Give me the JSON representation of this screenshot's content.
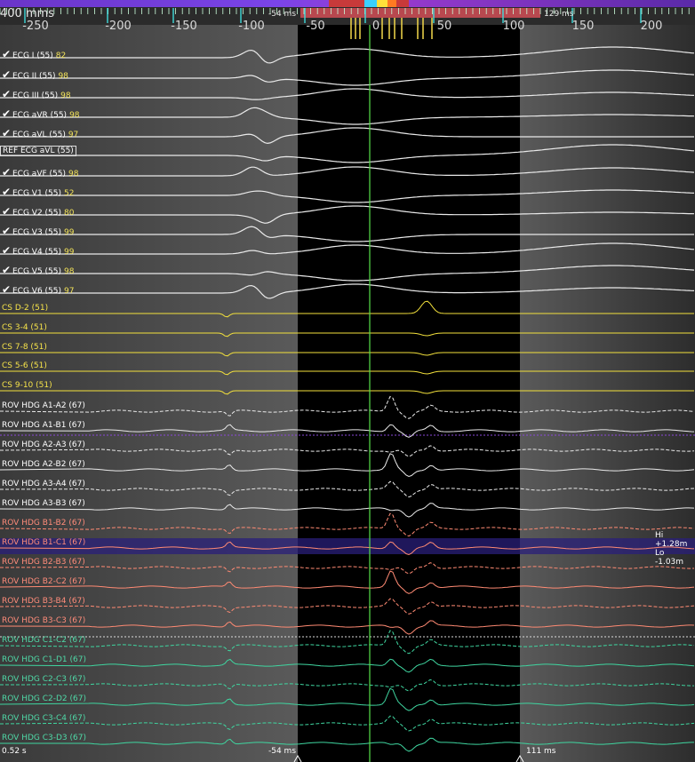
{
  "header": {
    "sweep_speed": "400 mms",
    "marker_left": "-54 ms",
    "marker_right": "129 ms",
    "ticks": [
      "-250",
      "-200",
      "-150",
      "-100",
      "-50",
      "0",
      "50",
      "100",
      "150",
      "200"
    ]
  },
  "channels": [
    {
      "label": "ECG I (55)",
      "score": "82",
      "checked": true,
      "color": "white"
    },
    {
      "label": "ECG II (55)",
      "score": "98",
      "checked": true,
      "color": "white"
    },
    {
      "label": "ECG III (55)",
      "score": "98",
      "checked": true,
      "color": "white"
    },
    {
      "label": "ECG aVR (55)",
      "score": "98",
      "checked": true,
      "color": "white"
    },
    {
      "label": "ECG aVL (55)",
      "score": "97",
      "checked": true,
      "color": "white"
    },
    {
      "label": "REF ECG aVL (55)",
      "score": "",
      "checked": false,
      "color": "white",
      "ref": true
    },
    {
      "label": "ECG aVF (55)",
      "score": "98",
      "checked": true,
      "color": "white"
    },
    {
      "label": "ECG V1 (55)",
      "score": "52",
      "checked": true,
      "color": "white"
    },
    {
      "label": "ECG V2 (55)",
      "score": "80",
      "checked": true,
      "color": "white"
    },
    {
      "label": "ECG V3 (55)",
      "score": "99",
      "checked": true,
      "color": "white"
    },
    {
      "label": "ECG V4 (55)",
      "score": "99",
      "checked": true,
      "color": "white"
    },
    {
      "label": "ECG V5 (55)",
      "score": "98",
      "checked": true,
      "color": "white"
    },
    {
      "label": "ECG V6 (55)",
      "score": "97",
      "checked": true,
      "color": "white"
    },
    {
      "label": "CS   D-2 (51)",
      "color": "yellow"
    },
    {
      "label": "CS   3-4 (51)",
      "color": "yellow"
    },
    {
      "label": "CS   7-8 (51)",
      "color": "yellow"
    },
    {
      "label": "CS   5-6 (51)",
      "color": "yellow"
    },
    {
      "label": "CS   9-10 (51)",
      "color": "yellow"
    },
    {
      "label": "ROV HDG   A1-A2 (67)",
      "color": "white"
    },
    {
      "label": "ROV HDG   A1-B1 (67)",
      "color": "white"
    },
    {
      "label": "ROV HDG   A2-A3 (67)",
      "color": "white"
    },
    {
      "label": "ROV HDG   A2-B2 (67)",
      "color": "white"
    },
    {
      "label": "ROV HDG   A3-A4 (67)",
      "color": "white"
    },
    {
      "label": "ROV HDG   A3-B3 (67)",
      "color": "white"
    },
    {
      "label": "ROV HDG   B1-B2 (67)",
      "color": "salmon"
    },
    {
      "label": "ROV HDG   B1-C1 (67)",
      "color": "salmon"
    },
    {
      "label": "ROV HDG   B2-B3 (67)",
      "color": "salmon"
    },
    {
      "label": "ROV HDG   B2-C2 (67)",
      "color": "salmon"
    },
    {
      "label": "ROV HDG   B3-B4 (67)",
      "color": "salmon"
    },
    {
      "label": "ROV HDG   B3-C3 (67)",
      "color": "salmon"
    },
    {
      "label": "ROV HDG   C1-C2 (67)",
      "color": "green"
    },
    {
      "label": "ROV HDG   C1-D1 (67)",
      "color": "green"
    },
    {
      "label": "ROV HDG   C2-C3 (67)",
      "color": "green"
    },
    {
      "label": "ROV HDG   C2-D2 (67)",
      "color": "green"
    },
    {
      "label": "ROV HDG   C3-C4 (67)",
      "color": "green"
    },
    {
      "label": "ROV HDG   C3-D3 (67)",
      "color": "green"
    }
  ],
  "side": {
    "hi": "Hi +1.28m",
    "lo": "Lo -1.03m"
  },
  "footer": {
    "time": "0.52 s",
    "left_marker": "-54 ms",
    "right_marker": "111 ms"
  },
  "colors": {
    "white": "#eaeaea",
    "yellow": "#f3e13c",
    "salmon": "#ff8a73",
    "green": "#3fd6a0",
    "accent": "#3fdcdc",
    "marker": "#56e04a"
  }
}
